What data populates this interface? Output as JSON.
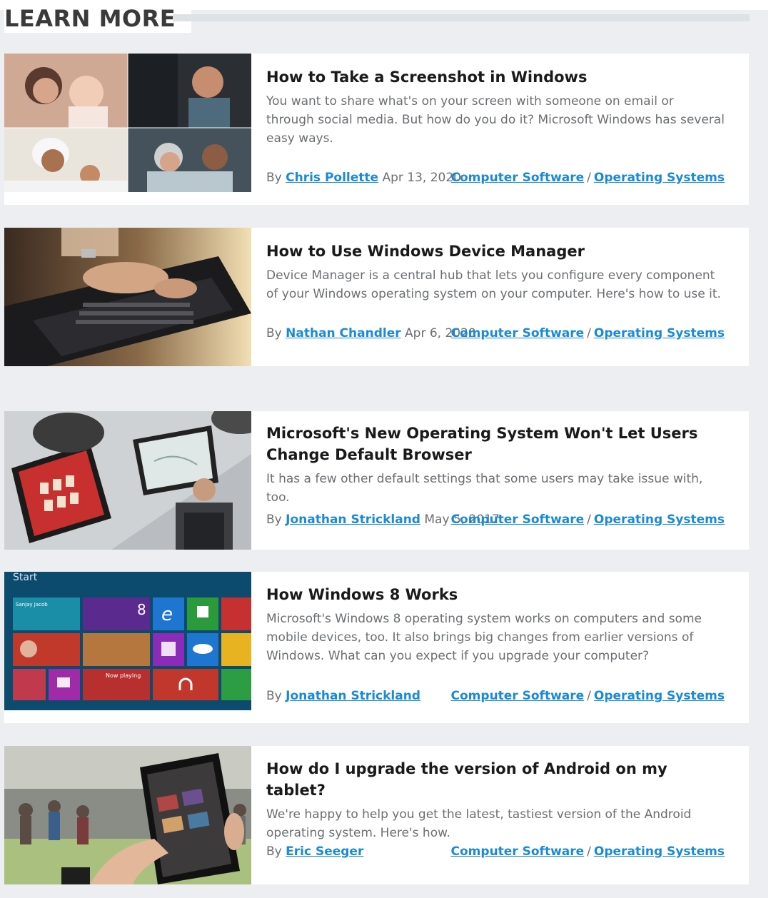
{
  "section": {
    "title": "LEARN MORE"
  },
  "articles": [
    {
      "title": "How to Take a Screenshot in Windows",
      "description": "You want to share what's on your screen with someone on email or through social media. But how do you do it? Microsoft Windows has several easy ways.",
      "by": "By",
      "author": "Chris Pollette",
      "date": "Apr 13, 2020",
      "category": "Computer Software",
      "separator": "/",
      "subcategory": "Operating Systems",
      "image": "family-photo-collage"
    },
    {
      "title": "How to Use Windows Device Manager",
      "description": "Device Manager is a central hub that lets you configure every component of your Windows operating system on your computer. Here's how to use it.",
      "by": "By",
      "author": "Nathan Chandler",
      "date": "Apr 6, 2020",
      "category": "Computer Software",
      "separator": "/",
      "subcategory": "Operating Systems",
      "image": "hands-typing-laptop"
    },
    {
      "title": "Microsoft's New Operating System Won't Let Users Change Default Browser",
      "description": "It has a few other default settings that some users may take issue with, too.",
      "by": "By",
      "author": "Jonathan Strickland",
      "date": "May 5, 2017",
      "category": "Computer Software",
      "separator": "/",
      "subcategory": "Operating Systems",
      "image": "tablets-presenter"
    },
    {
      "title": "How Windows 8 Works",
      "description": "Microsoft's Windows 8 operating system works on computers and some mobile devices, too. It also brings big changes from earlier versions of Windows. What can you expect if you upgrade your computer?",
      "by": "By",
      "author": "Jonathan Strickland",
      "date": "",
      "category": "Computer Software",
      "separator": "/",
      "subcategory": "Operating Systems",
      "image": "windows-8-start-screen",
      "image_text": {
        "start": "Start",
        "user": "Sanjay Jacob",
        "tile_8": "8",
        "now_playing": "Now playing"
      }
    },
    {
      "title": "How do I upgrade the version of Android on my tablet?",
      "description": "We're happy to help you get the latest, tastiest version of the Android operating system. Here's how.",
      "by": "By",
      "author": "Eric Seeger",
      "date": "",
      "category": "Computer Software",
      "separator": "/",
      "subcategory": "Operating Systems",
      "image": "hand-holding-android-tablet"
    }
  ],
  "colors": {
    "link": "#1a8ad6",
    "panel_bg": "#eceef1",
    "title_text": "#1a1a1a",
    "body_text": "#6b6e72",
    "win8_bg": "#0c4a6e"
  }
}
